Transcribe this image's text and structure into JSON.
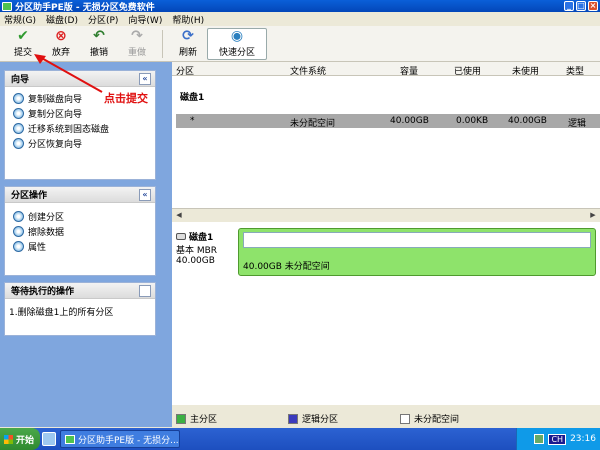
{
  "window": {
    "title": "分区助手PE版 - 无损分区免费软件"
  },
  "menu": [
    "常规(G)",
    "磁盘(D)",
    "分区(P)",
    "向导(W)",
    "帮助(H)"
  ],
  "toolbar": {
    "commit": "提交",
    "discard": "放弃",
    "undo": "撤销",
    "redo": "重做",
    "refresh": "刷新",
    "quick_partition": "快速分区"
  },
  "annotation": "点击提交",
  "wizard_panel": {
    "title": "向导",
    "items": [
      "复制磁盘向导",
      "复制分区向导",
      "迁移系统到固态磁盘",
      "分区恢复向导"
    ]
  },
  "partition_ops_panel": {
    "title": "分区操作",
    "items": [
      "创建分区",
      "擦除数据",
      "属性"
    ]
  },
  "pending_panel": {
    "title": "等待执行的操作",
    "items": [
      "1.删除磁盘1上的所有分区"
    ]
  },
  "table": {
    "columns": [
      "分区",
      "文件系统",
      "容量",
      "已使用",
      "未使用",
      "类型"
    ],
    "disk_label": "磁盘1",
    "rows": [
      {
        "partition": "*",
        "fs": "未分配空间",
        "capacity": "40.00GB",
        "used": "0.00KB",
        "free": "40.00GB",
        "type": "逻辑"
      }
    ]
  },
  "disk_map": {
    "name": "磁盘1",
    "kind": "基本 MBR",
    "size": "40.00GB",
    "bar_text": "40.00GB 未分配空间"
  },
  "legend": [
    "主分区",
    "逻辑分区",
    "未分配空间"
  ],
  "taskbar": {
    "start": "开始",
    "app": "分区助手PE版 - 无损分...",
    "ime": "CH",
    "time": "23:16"
  },
  "colors": {
    "unallocated_bar": "#8EE36B",
    "primary": "#3cb043",
    "logical": "#3b3bbd",
    "free": "#ffffff"
  }
}
